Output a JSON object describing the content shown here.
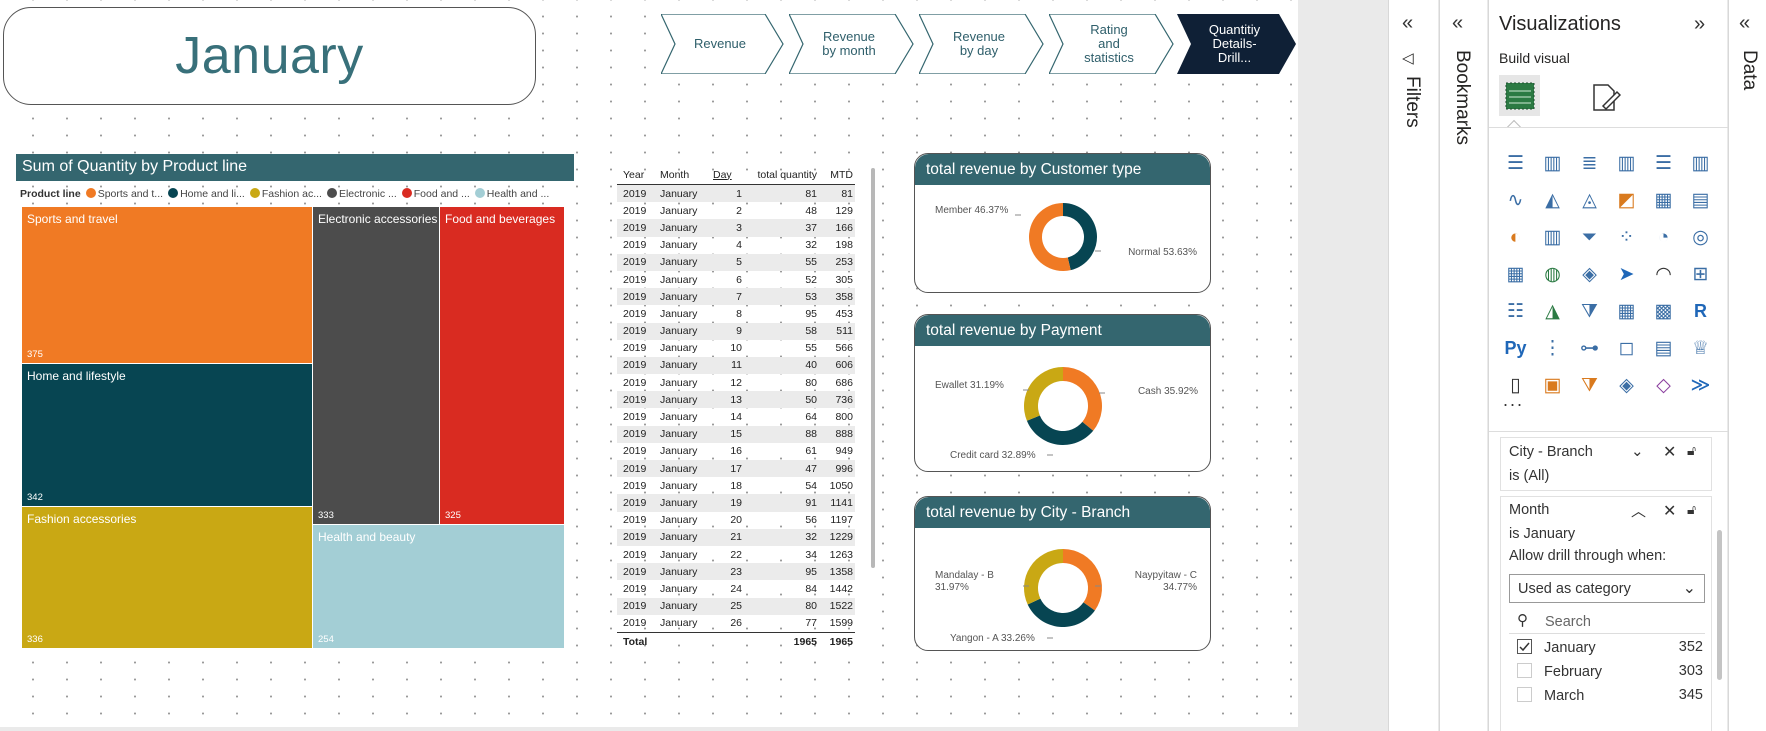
{
  "page_title": "January",
  "nav_buttons": [
    {
      "label": "Revenue"
    },
    {
      "label": "Revenue\nby month"
    },
    {
      "label": "Revenue\nby day"
    },
    {
      "label": "Rating\nand\nstatistics"
    },
    {
      "label": "Quantitiy\nDetails-\nDrill..."
    }
  ],
  "treemap": {
    "title": "Sum of Quantity by Product line",
    "legend_title": "Product line",
    "legend": [
      {
        "label": "Sports and t...",
        "color": "#f07a24"
      },
      {
        "label": "Home and li...",
        "color": "#074552"
      },
      {
        "label": "Fashion ac...",
        "color": "#c9a814"
      },
      {
        "label": "Electronic ...",
        "color": "#4c4c4c"
      },
      {
        "label": "Food and ...",
        "color": "#d92b21"
      },
      {
        "label": "Health and ...",
        "color": "#a3ced5"
      }
    ],
    "tiles": [
      {
        "name": "Sports and travel",
        "value": "375",
        "color": "#f07a24"
      },
      {
        "name": "Home and lifestyle",
        "value": "342",
        "color": "#074552"
      },
      {
        "name": "Fashion accessories",
        "value": "336",
        "color": "#c9a814"
      },
      {
        "name": "Electronic accessories",
        "value": "333",
        "color": "#4c4c4c"
      },
      {
        "name": "Food and beverages",
        "value": "325",
        "color": "#d92b21"
      },
      {
        "name": "Health and beauty",
        "value": "254",
        "color": "#a3ced5"
      }
    ]
  },
  "table": {
    "headers": [
      "Year",
      "Month",
      "Day",
      "total quantity",
      "MTD"
    ],
    "rows": [
      [
        "2019",
        "January",
        "1",
        "81",
        "81"
      ],
      [
        "2019",
        "January",
        "2",
        "48",
        "129"
      ],
      [
        "2019",
        "January",
        "3",
        "37",
        "166"
      ],
      [
        "2019",
        "January",
        "4",
        "32",
        "198"
      ],
      [
        "2019",
        "January",
        "5",
        "55",
        "253"
      ],
      [
        "2019",
        "January",
        "6",
        "52",
        "305"
      ],
      [
        "2019",
        "January",
        "7",
        "53",
        "358"
      ],
      [
        "2019",
        "January",
        "8",
        "95",
        "453"
      ],
      [
        "2019",
        "January",
        "9",
        "58",
        "511"
      ],
      [
        "2019",
        "January",
        "10",
        "55",
        "566"
      ],
      [
        "2019",
        "January",
        "11",
        "40",
        "606"
      ],
      [
        "2019",
        "January",
        "12",
        "80",
        "686"
      ],
      [
        "2019",
        "January",
        "13",
        "50",
        "736"
      ],
      [
        "2019",
        "January",
        "14",
        "64",
        "800"
      ],
      [
        "2019",
        "January",
        "15",
        "88",
        "888"
      ],
      [
        "2019",
        "January",
        "16",
        "61",
        "949"
      ],
      [
        "2019",
        "January",
        "17",
        "47",
        "996"
      ],
      [
        "2019",
        "January",
        "18",
        "54",
        "1050"
      ],
      [
        "2019",
        "January",
        "19",
        "91",
        "1141"
      ],
      [
        "2019",
        "January",
        "20",
        "56",
        "1197"
      ],
      [
        "2019",
        "January",
        "21",
        "32",
        "1229"
      ],
      [
        "2019",
        "January",
        "22",
        "34",
        "1263"
      ],
      [
        "2019",
        "January",
        "23",
        "95",
        "1358"
      ],
      [
        "2019",
        "January",
        "24",
        "84",
        "1442"
      ],
      [
        "2019",
        "January",
        "25",
        "80",
        "1522"
      ],
      [
        "2019",
        "January",
        "26",
        "77",
        "1599"
      ]
    ],
    "total_label": "Total",
    "total_quantity": "1965",
    "total_mtd": "1965"
  },
  "chart_data": [
    {
      "type": "pie",
      "title": "total revenue by Customer type",
      "slices": [
        {
          "label": "Member",
          "value": 46.37,
          "text": "Member 46.37%",
          "color": "#074552"
        },
        {
          "label": "Normal",
          "value": 53.63,
          "text": "Normal 53.63%",
          "color": "#f07a24"
        }
      ]
    },
    {
      "type": "pie",
      "title": "total revenue by Payment",
      "slices": [
        {
          "label": "Cash",
          "value": 35.92,
          "text": "Cash 35.92%",
          "color": "#f07a24"
        },
        {
          "label": "Credit card",
          "value": 32.89,
          "text": "Credit card 32.89%",
          "color": "#074552"
        },
        {
          "label": "Ewallet",
          "value": 31.19,
          "text": "Ewallet 31.19%",
          "color": "#c9a814"
        }
      ]
    },
    {
      "type": "pie",
      "title": "total revenue by City - Branch",
      "slices": [
        {
          "label": "Naypyitaw - C",
          "value": 34.77,
          "text": "Naypyitaw - C\n34.77%",
          "color": "#f07a24"
        },
        {
          "label": "Yangon - A",
          "value": 33.26,
          "text": "Yangon - A 33.26%",
          "color": "#074552"
        },
        {
          "label": "Mandalay - B",
          "value": 31.97,
          "text": "Mandalay - B\n31.97%",
          "color": "#c9a814"
        }
      ]
    }
  ],
  "panes": {
    "filters": "Filters",
    "bookmarks": "Bookmarks",
    "data": "Data"
  },
  "visualizations": {
    "title": "Visualizations",
    "build_visual": "Build visual",
    "icons": [
      "stacked-bar",
      "stacked-column",
      "clustered-bar",
      "clustered-column",
      "100-bar",
      "100-column",
      "line",
      "area",
      "stacked-area",
      "line-column",
      "ribbon",
      "waterfall",
      "scatter",
      "column-alt",
      "funnel",
      "scatter-dots",
      "pie",
      "donut",
      "treemap",
      "map",
      "filled-map",
      "azure-map",
      "gauge",
      "card",
      "multirow-card",
      "kpi",
      "slicer",
      "table",
      "matrix",
      "r-visual",
      "python-visual",
      "key-influencers",
      "decomposition-tree",
      "qa",
      "narrative",
      "trophy",
      "paginated-report",
      "card-new",
      "slicer-new",
      "power-apps",
      "diamond",
      "power-automate"
    ],
    "more": "..."
  },
  "filters": {
    "city_branch": {
      "title": "City - Branch",
      "state": "is (All)"
    },
    "month": {
      "title": "Month",
      "state": "is January",
      "drill_label": "Allow drill through when:",
      "drill_option": "Used as category",
      "search_placeholder": "Search",
      "items": [
        {
          "label": "January",
          "count": "352",
          "checked": true
        },
        {
          "label": "February",
          "count": "303",
          "checked": false
        },
        {
          "label": "March",
          "count": "345",
          "checked": false
        }
      ]
    }
  }
}
